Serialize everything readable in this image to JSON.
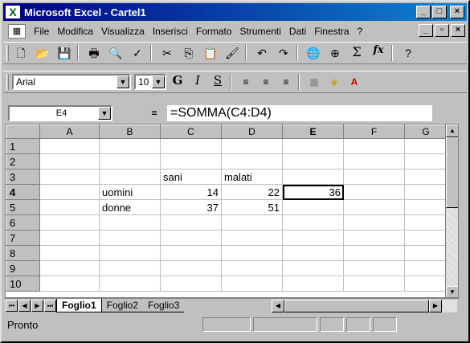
{
  "titlebar": {
    "app_icon": "X",
    "title": "Microsoft Excel - Cartel1",
    "minimize": "_",
    "maximize": "□",
    "close": "×"
  },
  "menubar": {
    "items": [
      {
        "label": "File"
      },
      {
        "label": "Modifica"
      },
      {
        "label": "Visualizza"
      },
      {
        "label": "Inserisci"
      },
      {
        "label": "Formato"
      },
      {
        "label": "Strumenti"
      },
      {
        "label": "Dati"
      },
      {
        "label": "Finestra"
      },
      {
        "label": "?"
      }
    ],
    "doc_minimize": "_",
    "doc_restore": "▫",
    "doc_close": "×"
  },
  "toolbar_standard": {
    "icons": [
      "new-icon",
      "open-icon",
      "save-icon",
      "print-icon",
      "print-preview-icon",
      "spelling-icon",
      "cut-icon",
      "copy-icon",
      "paste-icon",
      "format-painter-icon",
      "undo-icon",
      "redo-icon",
      "hyperlink-icon",
      "web-icon",
      "autosum-icon",
      "function-icon",
      "help-icon"
    ],
    "autosum": "Σ",
    "function": "fx"
  },
  "toolbar_formatting": {
    "font": "Arial",
    "size": "10",
    "bold": "G",
    "italic": "I",
    "underline": "S"
  },
  "formulabar": {
    "namebox": "E4",
    "equals": "=",
    "formula": "=SOMMA(C4:D4)"
  },
  "sheet": {
    "columns": [
      "",
      "A",
      "B",
      "C",
      "D",
      "E",
      "F",
      "G"
    ],
    "active_col": "E",
    "active_row": "4",
    "rows": [
      {
        "num": "1",
        "cells": [
          "",
          "",
          "",
          "",
          "",
          "",
          ""
        ]
      },
      {
        "num": "2",
        "cells": [
          "",
          "",
          "",
          "",
          "",
          "",
          ""
        ]
      },
      {
        "num": "3",
        "cells": [
          "",
          "",
          "sani",
          "malati",
          "",
          "",
          ""
        ]
      },
      {
        "num": "4",
        "cells": [
          "",
          "uomini",
          "14",
          "22",
          "36",
          "",
          ""
        ]
      },
      {
        "num": "5",
        "cells": [
          "",
          "donne",
          "37",
          "51",
          "",
          "",
          ""
        ]
      },
      {
        "num": "6",
        "cells": [
          "",
          "",
          "",
          "",
          "",
          "",
          ""
        ]
      },
      {
        "num": "7",
        "cells": [
          "",
          "",
          "",
          "",
          "",
          "",
          ""
        ]
      },
      {
        "num": "8",
        "cells": [
          "",
          "",
          "",
          "",
          "",
          "",
          ""
        ]
      },
      {
        "num": "9",
        "cells": [
          "",
          "",
          "",
          "",
          "",
          "",
          ""
        ]
      },
      {
        "num": "10",
        "cells": [
          "",
          "",
          "",
          "",
          "",
          "",
          ""
        ]
      }
    ]
  },
  "tabs": [
    {
      "label": "Foglio1",
      "active": true
    },
    {
      "label": "Foglio2"
    },
    {
      "label": "Foglio3"
    }
  ],
  "status": {
    "text": "Pronto"
  }
}
